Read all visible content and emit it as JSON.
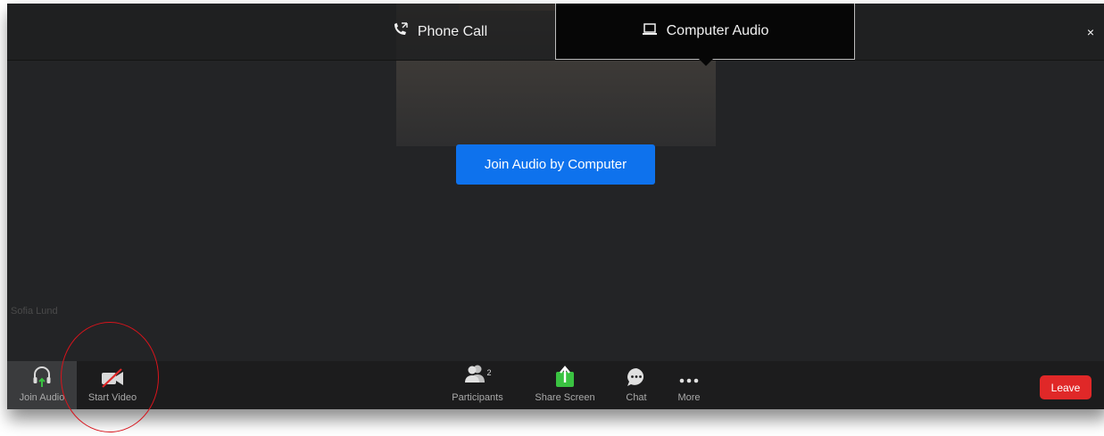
{
  "top_bar": {
    "phone_tab_label": "Phone Call",
    "computer_tab_label": "Computer Audio",
    "close_label": "×"
  },
  "main": {
    "join_button_label": "Join Audio by Computer",
    "participant_name": "Sofia Lund"
  },
  "toolbar": {
    "join_audio_label": "Join Audio",
    "start_video_label": "Start Video",
    "participants_label": "Participants",
    "participants_count": "2",
    "share_screen_label": "Share Screen",
    "chat_label": "Chat",
    "more_label": "More",
    "leave_label": "Leave"
  },
  "colors": {
    "accent_blue": "#0e72ed",
    "leave_red": "#e02828",
    "share_green": "#3ac241",
    "annotation_red": "#d8141c"
  }
}
